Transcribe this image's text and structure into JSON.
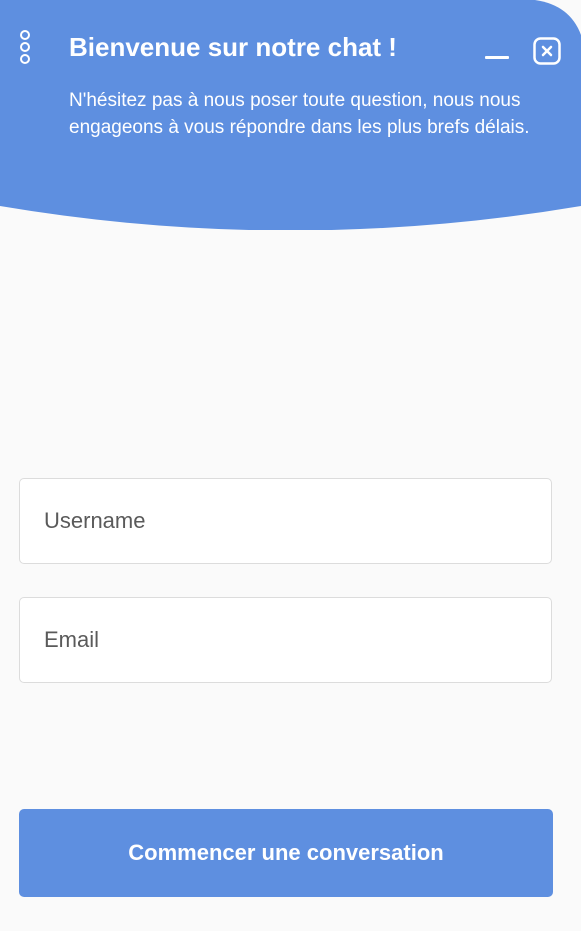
{
  "colors": {
    "accent": "#5e8fe0",
    "page_background": "#fafafa",
    "header_text": "#ffffff"
  },
  "header": {
    "menu_icon": "vertical-dots-icon",
    "title": "Bienvenue sur notre chat !",
    "subtitle": "N'hésitez pas à nous poser toute question, nous nous engageons à vous répondre dans les plus brefs délais.",
    "minimize_icon": "minimize-icon",
    "close_icon": "close-icon"
  },
  "form": {
    "username": {
      "placeholder": "Username",
      "value": ""
    },
    "email": {
      "placeholder": "Email",
      "value": ""
    },
    "submit_label": "Commencer une conversation"
  }
}
